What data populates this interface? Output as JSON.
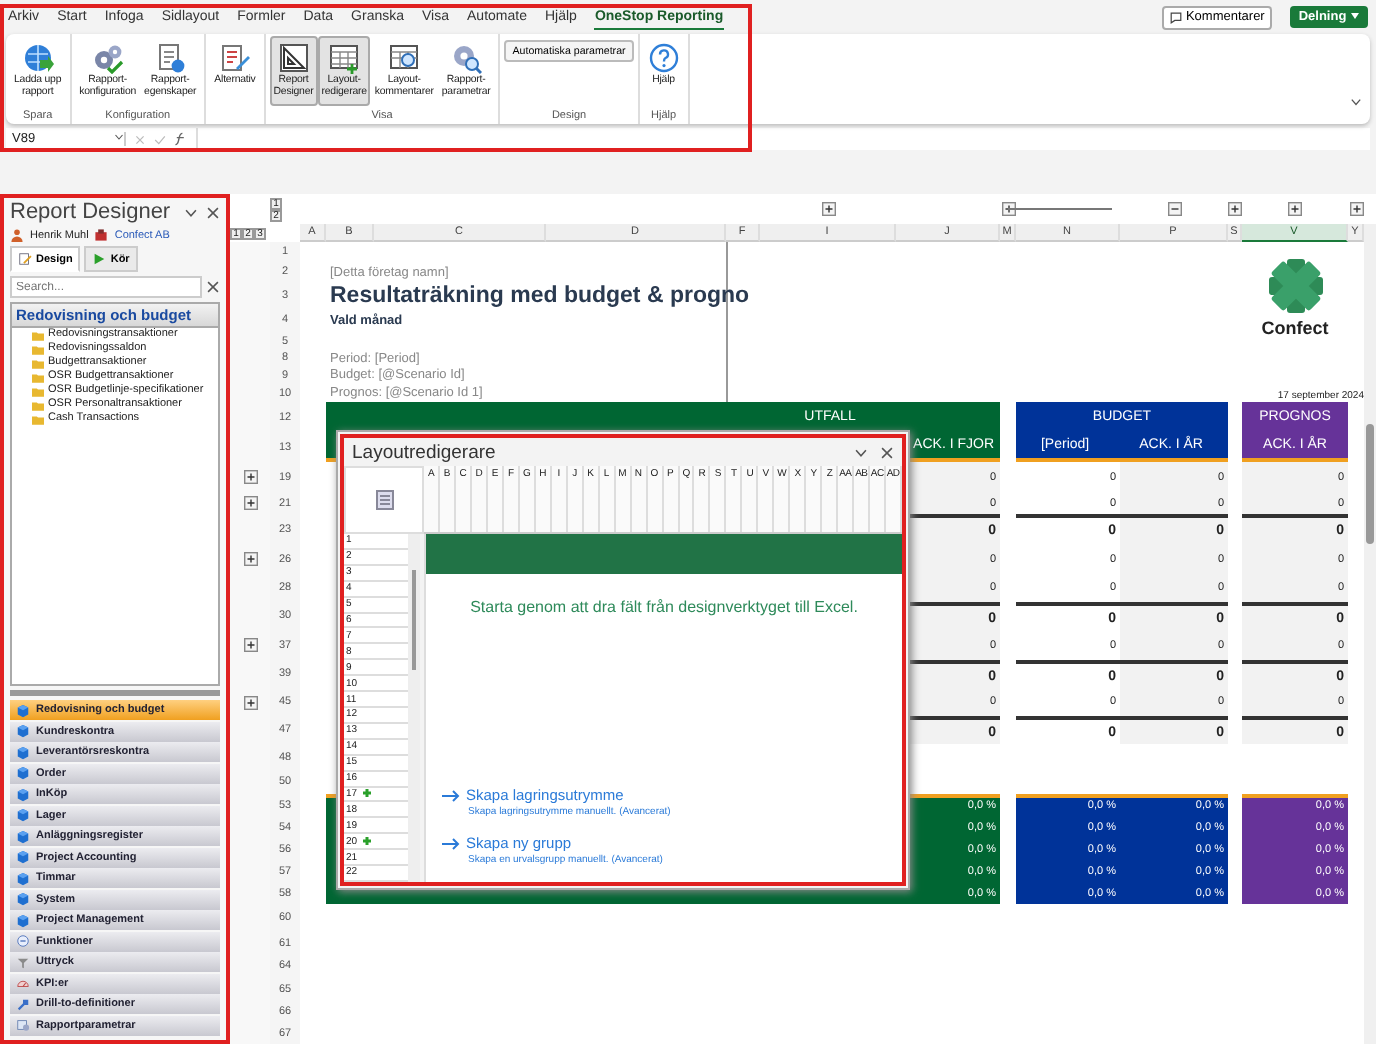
{
  "ribbon": {
    "tabs": [
      {
        "label": "Arkiv",
        "selected": false
      },
      {
        "label": "Start",
        "selected": false
      },
      {
        "label": "Infoga",
        "selected": false
      },
      {
        "label": "Sidlayout",
        "selected": false
      },
      {
        "label": "Formler",
        "selected": false
      },
      {
        "label": "Data",
        "selected": false
      },
      {
        "label": "Granska",
        "selected": false
      },
      {
        "label": "Visa",
        "selected": false
      },
      {
        "label": "Automate",
        "selected": false
      },
      {
        "label": "Hjälp",
        "selected": false
      },
      {
        "label": "OneStop Reporting",
        "selected": true
      }
    ],
    "comments_button": "Kommentarer",
    "share_button": "Delning",
    "groups": [
      {
        "label": "Spara",
        "buttons": [
          {
            "label": "Ladda upp\nrapport",
            "kind": "globe",
            "selected": false
          }
        ]
      },
      {
        "label": "Konfiguration",
        "buttons": [
          {
            "label": "Rapport-\nkonfiguration",
            "kind": "gears",
            "selected": false
          },
          {
            "label": "Rapport-\negenskaper",
            "kind": "doc-info",
            "selected": false
          }
        ]
      },
      {
        "buttons": [
          {
            "label": "Alternativ",
            "kind": "doc-pen",
            "selected": false
          }
        ]
      },
      {
        "label": "Visa",
        "buttons": [
          {
            "label": "Report\nDesigner",
            "kind": "ruler",
            "selected": true
          },
          {
            "label": "Layout-\nredigerare",
            "kind": "grid",
            "selected": true
          },
          {
            "label": "Layout-\nkommentarer",
            "kind": "grid-search",
            "selected": false
          },
          {
            "label": "Rapport-\nparametrar",
            "kind": "gear-search",
            "selected": false
          }
        ]
      },
      {
        "label": "Design",
        "small_buttons": [
          "Automatiska parametrar"
        ]
      },
      {
        "label": "Hjälp",
        "buttons": [
          {
            "label": "Hjälp",
            "kind": "help",
            "selected": false
          }
        ]
      }
    ],
    "name_box": "V89"
  },
  "report_designer": {
    "title": "Report Designer",
    "user": "Henrik Muhl",
    "company": "Confect AB",
    "tabs": [
      {
        "label": "Design",
        "kind": "design",
        "selected": true
      },
      {
        "label": "Kör",
        "kind": "run",
        "selected": false
      }
    ],
    "search": {
      "placeholder": "Search..."
    },
    "tree_title": "Redovisning och budget",
    "tree_items": [
      "Redovisningstransaktioner",
      "Redovisningssaldon",
      "Budgettransaktioner",
      "OSR Budgettransaktioner",
      "OSR Budgetlinje-specifikationer",
      "OSR Personaltransaktioner",
      "Cash Transactions"
    ],
    "modules": [
      {
        "label": "Redovisning och budget",
        "kind": "cube",
        "selected": true
      },
      {
        "label": "Kundreskontra",
        "kind": "cube",
        "selected": false
      },
      {
        "label": "Leverantörsreskontra",
        "kind": "cube",
        "selected": false
      },
      {
        "label": "Order",
        "kind": "cube",
        "selected": false
      },
      {
        "label": "InKöp",
        "kind": "cube",
        "selected": false
      },
      {
        "label": "Lager",
        "kind": "cube",
        "selected": false
      },
      {
        "label": "Anläggningsregister",
        "kind": "cube",
        "selected": false
      },
      {
        "label": "Project Accounting",
        "kind": "cube",
        "selected": false
      },
      {
        "label": "Timmar",
        "kind": "cube",
        "selected": false
      },
      {
        "label": "System",
        "kind": "cube",
        "selected": false
      },
      {
        "label": "Project Management",
        "kind": "cube",
        "selected": false
      },
      {
        "label": "Funktioner",
        "kind": "function",
        "selected": false
      },
      {
        "label": "Uttryck",
        "kind": "expression",
        "selected": false
      },
      {
        "label": "KPI:er",
        "kind": "kpi",
        "selected": false
      },
      {
        "label": "Drill-to-definitioner",
        "kind": "drill",
        "selected": false
      },
      {
        "label": "Rapportparametrar",
        "kind": "params",
        "selected": false
      }
    ]
  },
  "sheet": {
    "row_levels": [
      "1",
      "2",
      "3"
    ],
    "column_levels": [
      "1",
      "2"
    ],
    "column_outline": [
      {
        "expanded": false
      },
      {
        "expanded": false
      },
      {
        "expanded": true
      },
      {
        "expanded": false
      },
      {
        "expanded": false
      },
      {
        "expanded": false
      }
    ],
    "columns": [
      {
        "label": "A",
        "selected": false
      },
      {
        "label": "B",
        "selected": false
      },
      {
        "label": "C",
        "selected": false
      },
      {
        "label": "D",
        "selected": false
      },
      {
        "label": "F",
        "selected": false
      },
      {
        "label": "I",
        "selected": false
      },
      {
        "label": "J",
        "selected": false
      },
      {
        "label": "M",
        "selected": false
      },
      {
        "label": "N",
        "selected": false
      },
      {
        "label": "P",
        "selected": false
      },
      {
        "label": "S",
        "selected": false
      },
      {
        "label": "V",
        "selected": true
      },
      {
        "label": "Y",
        "selected": false
      }
    ],
    "rows": [
      {
        "label": "1",
        "outline_button": false
      },
      {
        "label": "2",
        "outline_button": false
      },
      {
        "label": "3",
        "outline_button": false
      },
      {
        "label": "4",
        "outline_button": false
      },
      {
        "label": "5",
        "outline_button": false
      },
      {
        "label": "8",
        "outline_button": false
      },
      {
        "label": "9",
        "outline_button": false
      },
      {
        "label": "10",
        "outline_button": false
      },
      {
        "label": "12",
        "outline_button": false
      },
      {
        "label": "13",
        "outline_button": false
      },
      {
        "label": "19",
        "outline_button": true
      },
      {
        "label": "21",
        "outline_button": true
      },
      {
        "label": "23",
        "outline_button": false
      },
      {
        "label": "26",
        "outline_button": true
      },
      {
        "label": "28",
        "outline_button": false
      },
      {
        "label": "30",
        "outline_button": false
      },
      {
        "label": "37",
        "outline_button": true
      },
      {
        "label": "39",
        "outline_button": false
      },
      {
        "label": "45",
        "outline_button": true
      },
      {
        "label": "47",
        "outline_button": false
      },
      {
        "label": "48",
        "outline_button": false
      },
      {
        "label": "50",
        "outline_button": false
      },
      {
        "label": "53",
        "outline_button": false
      },
      {
        "label": "54",
        "outline_button": false
      },
      {
        "label": "56",
        "outline_button": false
      },
      {
        "label": "57",
        "outline_button": false
      },
      {
        "label": "58",
        "outline_button": false
      },
      {
        "label": "60",
        "outline_button": false
      },
      {
        "label": "61",
        "outline_button": false
      },
      {
        "label": "64",
        "outline_button": false
      },
      {
        "label": "65",
        "outline_button": false
      },
      {
        "label": "66",
        "outline_button": false
      },
      {
        "label": "67",
        "outline_button": false
      }
    ],
    "company": "[Detta företag namn]",
    "title": "Resultaträkning med budget & progno",
    "subtitle": "Vald månad",
    "parameters": [
      "Period: [Period]",
      "Budget: [@Scenario Id]",
      "Prognos: [@Scenario Id 1]"
    ],
    "logo_text": "Confect",
    "date": "17 september 2024",
    "headers": [
      {
        "title": "UTFALL",
        "labels": [
          "ACK. I FJOR"
        ],
        "color": "#006633"
      },
      {
        "title": "BUDGET",
        "labels": [
          "[Period]",
          "ACK. I ÅR"
        ],
        "color": "#003399"
      },
      {
        "title": "PROGNOS",
        "labels": [
          "ACK. I ÅR"
        ],
        "color": "#663399"
      }
    ],
    "value_rows": [
      {
        "kind": "detail",
        "values": [
          "0",
          "0",
          "0",
          "0"
        ]
      },
      {
        "kind": "detail",
        "values": [
          "0",
          "0",
          "0",
          "0"
        ]
      },
      {
        "kind": "total",
        "values": [
          "0",
          "0",
          "0",
          "0"
        ]
      },
      {
        "kind": "detail",
        "values": [
          "0",
          "0",
          "0",
          "0"
        ]
      },
      {
        "kind": "detail",
        "values": [
          "0",
          "0",
          "0",
          "0"
        ]
      },
      {
        "kind": "total",
        "values": [
          "0",
          "0",
          "0",
          "0"
        ]
      },
      {
        "kind": "detail",
        "values": [
          "0",
          "0",
          "0",
          "0"
        ]
      },
      {
        "kind": "total",
        "values": [
          "0",
          "0",
          "0",
          "0"
        ]
      },
      {
        "kind": "detail",
        "values": [
          "0",
          "0",
          "0",
          "0"
        ]
      },
      {
        "kind": "total",
        "values": [
          "0",
          "0",
          "0",
          "0"
        ]
      }
    ],
    "percent_rows": [
      {
        "values": [
          "0,0 %",
          "0,0 %",
          "0,0 %",
          "0,0 %"
        ]
      },
      {
        "values": [
          "0,0 %",
          "0,0 %",
          "0,0 %",
          "0,0 %"
        ]
      },
      {
        "values": [
          "0,0 %",
          "0,0 %",
          "0,0 %",
          "0,0 %"
        ]
      },
      {
        "values": [
          "0,0 %",
          "0,0 %",
          "0,0 %",
          "0,0 %"
        ]
      },
      {
        "values": [
          "0,0 %",
          "0,0 %",
          "0,0 %",
          "0,0 %"
        ]
      }
    ]
  },
  "layout_editor": {
    "title": "Layoutredigerare",
    "columns": [
      "A",
      "B",
      "C",
      "D",
      "E",
      "F",
      "G",
      "H",
      "I",
      "J",
      "K",
      "L",
      "M",
      "N",
      "O",
      "P",
      "Q",
      "R",
      "S",
      "T",
      "U",
      "V",
      "W",
      "X",
      "Y",
      "Z",
      "AA",
      "AB",
      "AC",
      "AD"
    ],
    "rows": [
      {
        "label": "1",
        "marker": false
      },
      {
        "label": "2",
        "marker": false
      },
      {
        "label": "3",
        "marker": false
      },
      {
        "label": "4",
        "marker": false
      },
      {
        "label": "5",
        "marker": false
      },
      {
        "label": "6",
        "marker": false
      },
      {
        "label": "7",
        "marker": false
      },
      {
        "label": "8",
        "marker": false
      },
      {
        "label": "9",
        "marker": false
      },
      {
        "label": "10",
        "marker": false
      },
      {
        "label": "11",
        "marker": false
      },
      {
        "label": "12",
        "marker": false
      },
      {
        "label": "13",
        "marker": false
      },
      {
        "label": "14",
        "marker": false
      },
      {
        "label": "15",
        "marker": false
      },
      {
        "label": "16",
        "marker": false
      },
      {
        "label": "17",
        "marker": true
      },
      {
        "label": "18",
        "marker": false
      },
      {
        "label": "19",
        "marker": false
      },
      {
        "label": "20",
        "marker": true
      },
      {
        "label": "21",
        "marker": false
      },
      {
        "label": "22",
        "marker": false
      }
    ],
    "message": "Starta genom att dra fält från designverktyget till Excel.",
    "actions": [
      {
        "title": "Skapa lagringsutrymme",
        "description": "Skapa lagringsutrymme manuellt. (Avancerat)"
      },
      {
        "title": "Skapa ny grupp",
        "description": "Skapa en urvalsgrupp manuellt. (Avancerat)"
      }
    ]
  }
}
